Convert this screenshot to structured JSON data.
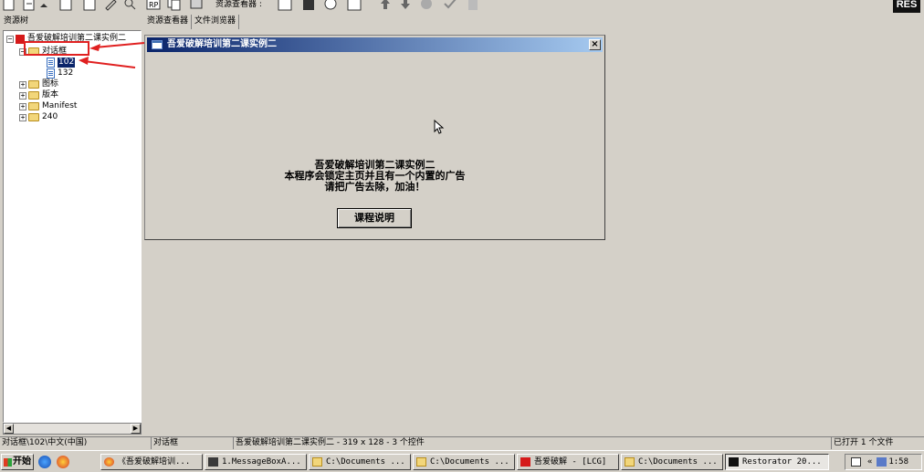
{
  "toolbar": {
    "resource_viewer_label": "资源查看器 :",
    "logo_text": "RES"
  },
  "left_pane": {
    "header": "资源树"
  },
  "right_tabs": [
    "资源查看器",
    "文件浏览器"
  ],
  "tree": {
    "root": "吾爱破解培训第二课实例二",
    "dialog_folder": "对话框",
    "item_102": "102",
    "item_132": "132",
    "icon_folder": "图标",
    "version_folder": "版本",
    "manifest_folder": "Manifest",
    "folder_240": "240"
  },
  "dialog": {
    "title": "吾爱破解培训第二课实例二",
    "close": "×",
    "line1": "吾爱破解培训第二课实例二",
    "line2": "本程序会锁定主页并且有一个内置的广告",
    "line3": "请把广告去除，加油！",
    "button": "课程说明"
  },
  "status": {
    "path": "对话框\\102\\中文(中国)",
    "type": "对话框",
    "info": "吾爱破解培训第二课实例二 - 319 x 128 - 3 个控件",
    "open_files": "已打开 1 个文件"
  },
  "taskbar": {
    "start": "开始",
    "tasks": [
      "《吾爱破解培训...",
      "1.MessageBoxA...",
      "C:\\Documents ...",
      "C:\\Documents ...",
      "吾爱破解 - [LCG]",
      "C:\\Documents ...",
      "Restorator 20..."
    ],
    "tray_chevron": "«",
    "clock": "1:58"
  },
  "colors": {
    "title_start": "#0a246a",
    "title_end": "#a6caf0",
    "annotation": "#e02020",
    "selection": "#0a246a"
  }
}
